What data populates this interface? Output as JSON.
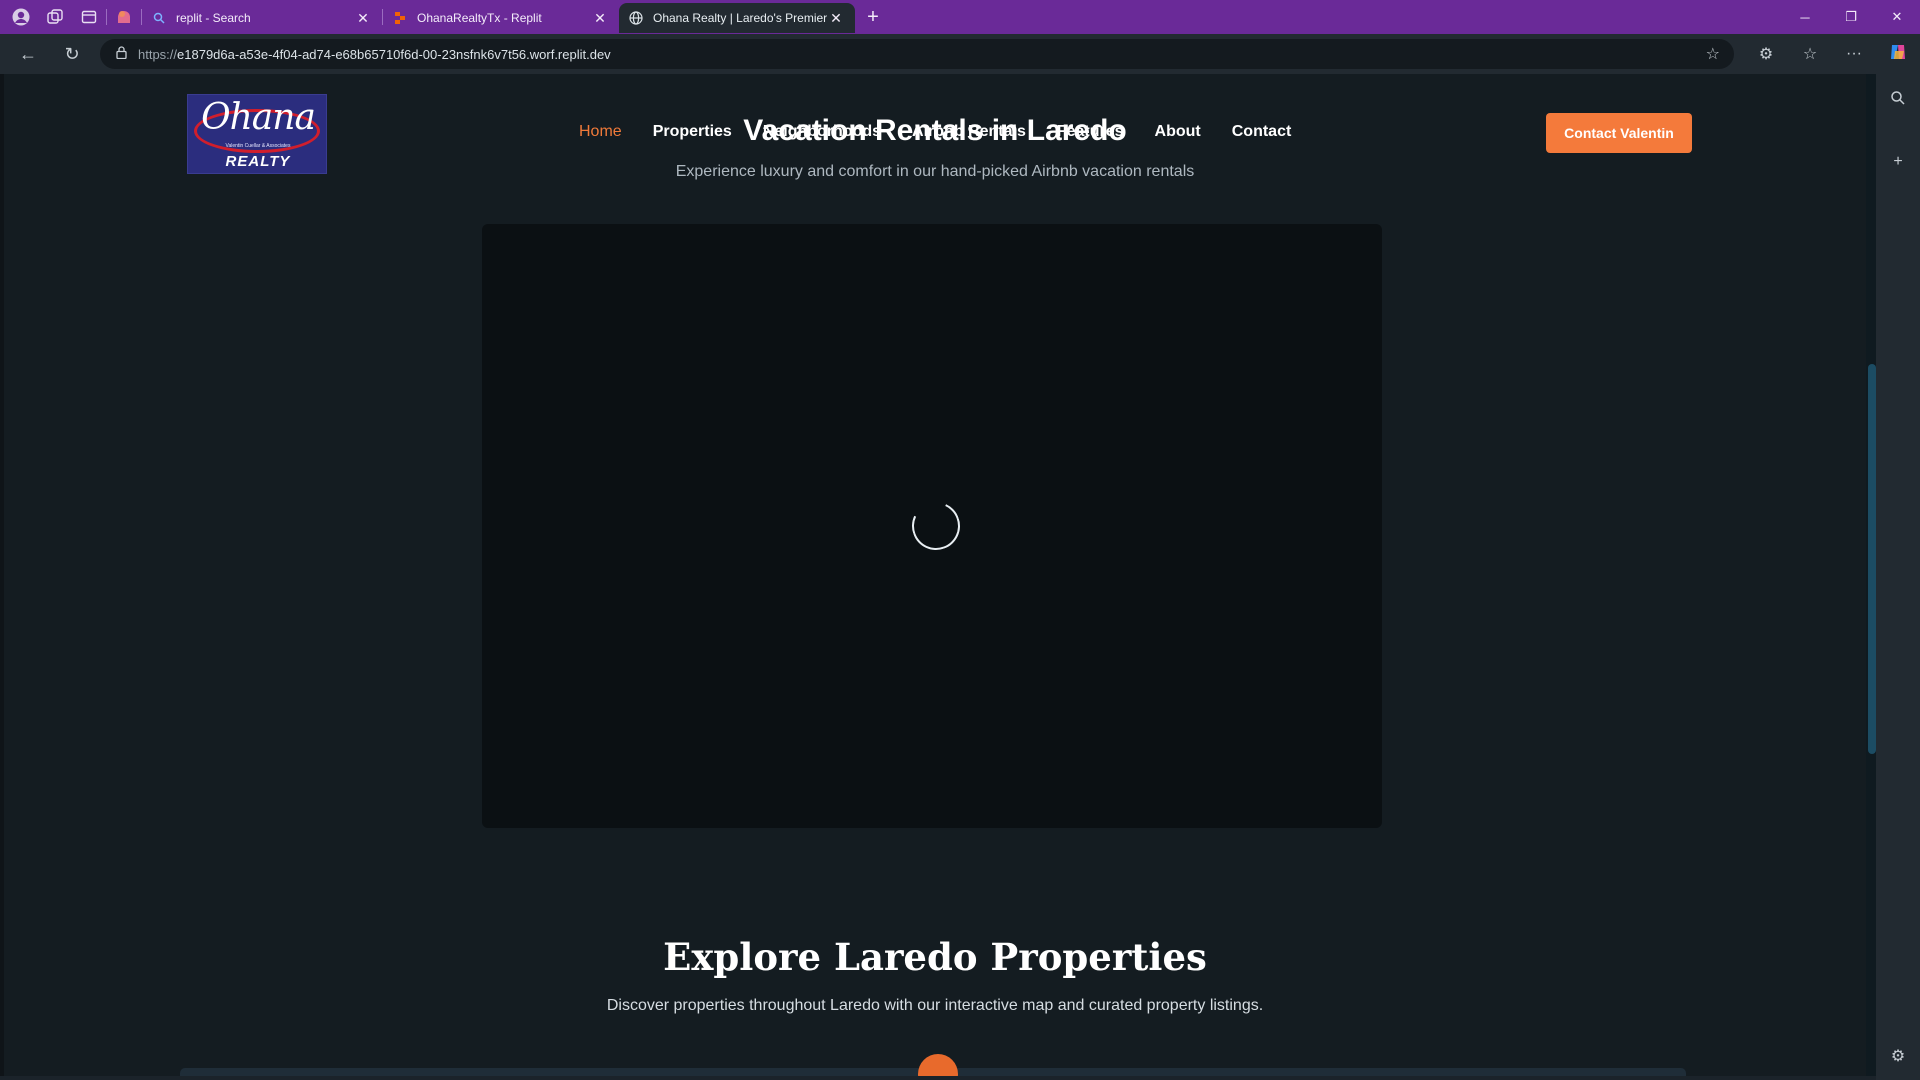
{
  "browser": {
    "tabs": [
      {
        "title": "replit - Search",
        "active": false
      },
      {
        "title": "OhanaRealtyTx - Replit",
        "active": false
      },
      {
        "title": "Ohana Realty | Laredo's Premier R",
        "active": true
      }
    ],
    "url_scheme": "https://",
    "url_rest": "e1879d6a-a53e-4f04-ad74-e68b65710f6d-00-23nsfnk6v7t56.worf.replit.dev"
  },
  "site": {
    "logo": {
      "word": "Ohana",
      "sub": "Valentin Cuellar & Associates",
      "realty": "REALTY"
    },
    "nav": [
      {
        "label": "Home",
        "active": true
      },
      {
        "label": "Properties",
        "active": false
      },
      {
        "label": "Neighborhoods",
        "active": false
      },
      {
        "label": "Airbnb Rentals",
        "active": false
      },
      {
        "label": "Features",
        "active": false
      },
      {
        "label": "About",
        "active": false
      },
      {
        "label": "Contact",
        "active": false
      }
    ],
    "cta_label": "Contact Valentin"
  },
  "hero": {
    "title": "Vacation Rentals in Laredo",
    "subtitle": "Experience luxury and comfort in our hand-picked Airbnb vacation rentals"
  },
  "explore": {
    "title": "Explore Laredo Properties",
    "subtitle": "Discover properties throughout Laredo with our interactive map and curated property listings."
  },
  "colors": {
    "accent": "#f47a3b",
    "tabbar": "#6a2a98",
    "page_bg": "#141c21"
  }
}
